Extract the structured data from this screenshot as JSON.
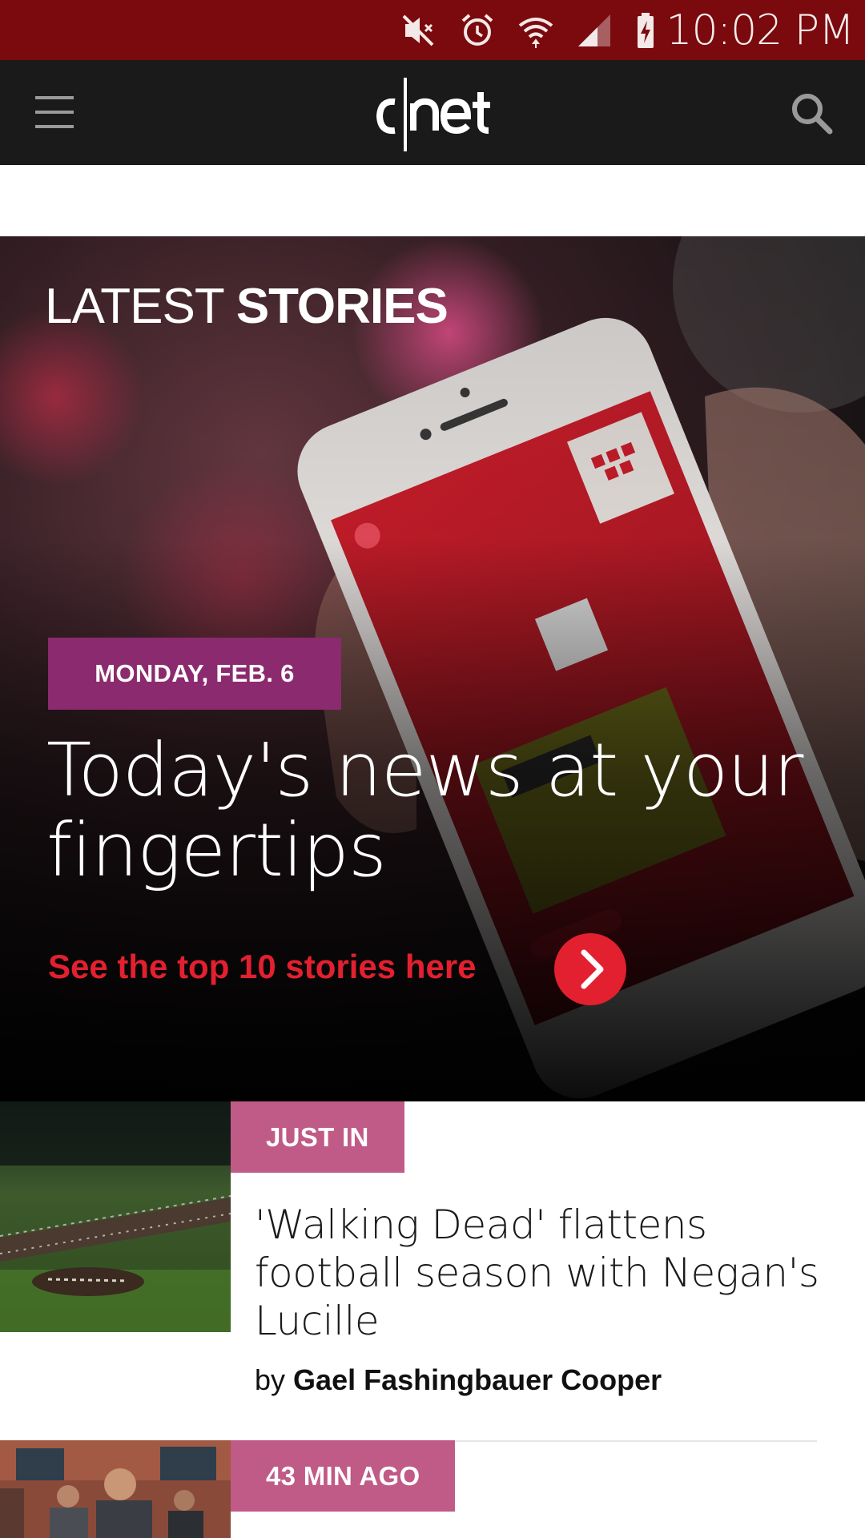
{
  "status_bar": {
    "time": "10:02 PM",
    "icons": [
      "mute-icon",
      "alarm-icon",
      "wifi-icon",
      "signal-icon",
      "battery-charging-icon"
    ],
    "background": "#7a0a0d"
  },
  "app_bar": {
    "logo_text": "c|net",
    "icons": [
      "hamburger-menu-icon",
      "search-icon"
    ],
    "background": "#1a1a1a"
  },
  "hero": {
    "section_title_light": "LATEST",
    "section_title_bold": "STORIES",
    "date_badge": "MONDAY, FEB. 6",
    "headline": "Today's news at your fingertips",
    "cta_text": "See the top 10 stories here",
    "cta_icon": "chevron-right-icon",
    "badge_color": "#8b2a6f",
    "accent_color": "#e3202f"
  },
  "articles": [
    {
      "tag": "JUST IN",
      "title": "'Walking Dead' flattens football season with Negan's Lucille",
      "by_label": "by",
      "author": "Gael Fashingbauer Cooper",
      "thumbnail": "barbed-wire-bat-on-football-field-image"
    },
    {
      "tag": "43 MIN AGO",
      "thumbnail": "kids-with-proton-packs-image"
    }
  ],
  "colors": {
    "tag": "#c05a86"
  }
}
